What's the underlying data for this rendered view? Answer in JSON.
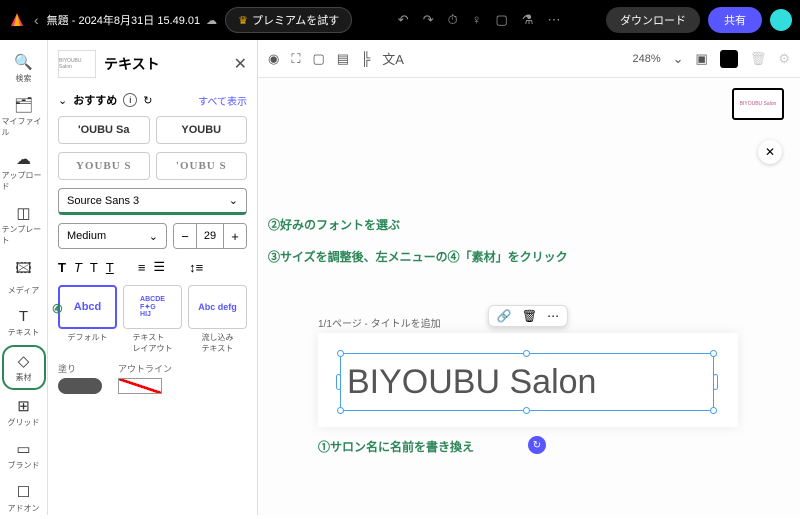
{
  "header": {
    "doc_title": "無題 - 2024年8月31日 15.49.01",
    "premium": "プレミアムを試す",
    "download": "ダウンロード",
    "share": "共有"
  },
  "rail": {
    "search": "検索",
    "files": "マイファイル",
    "upload": "アップロード",
    "template": "テンプレート",
    "media": "メディア",
    "text": "テキスト",
    "elements": "素材",
    "grid": "グリッド",
    "brand": "ブランド",
    "addon": "アドオン"
  },
  "sidebar": {
    "title": "テキスト",
    "thumb": "BIYOUBU Salon",
    "recommend": "おすすめ",
    "show_all": "すべて表示",
    "preset1": "'OUBU Sa",
    "preset2": "YOUBU",
    "preset3": "YOUBU S",
    "preset4": "'OUBU S",
    "font": "Source Sans 3",
    "weight": "Medium",
    "size": "29",
    "cards": {
      "default": "デフォルト",
      "layout": "テキスト\nレイアウト",
      "flow": "流し込み\nテキスト",
      "c1": "Abcd",
      "c3": "Abc\ndefg"
    },
    "fill": "塗り",
    "outline": "アウトライン"
  },
  "canvas": {
    "zoom": "248%",
    "page_label": "1/1ページ - タイトルを追加",
    "text_content": "BIYOUBU Salon",
    "mini": "BIYOUBU Salon"
  },
  "annotations": {
    "a1": "①サロン名に名前を書き換え",
    "a2": "②好みのフォントを選ぶ",
    "a3": "③サイズを調整後、左メニューの④「素材」をクリック",
    "a4": "④"
  }
}
